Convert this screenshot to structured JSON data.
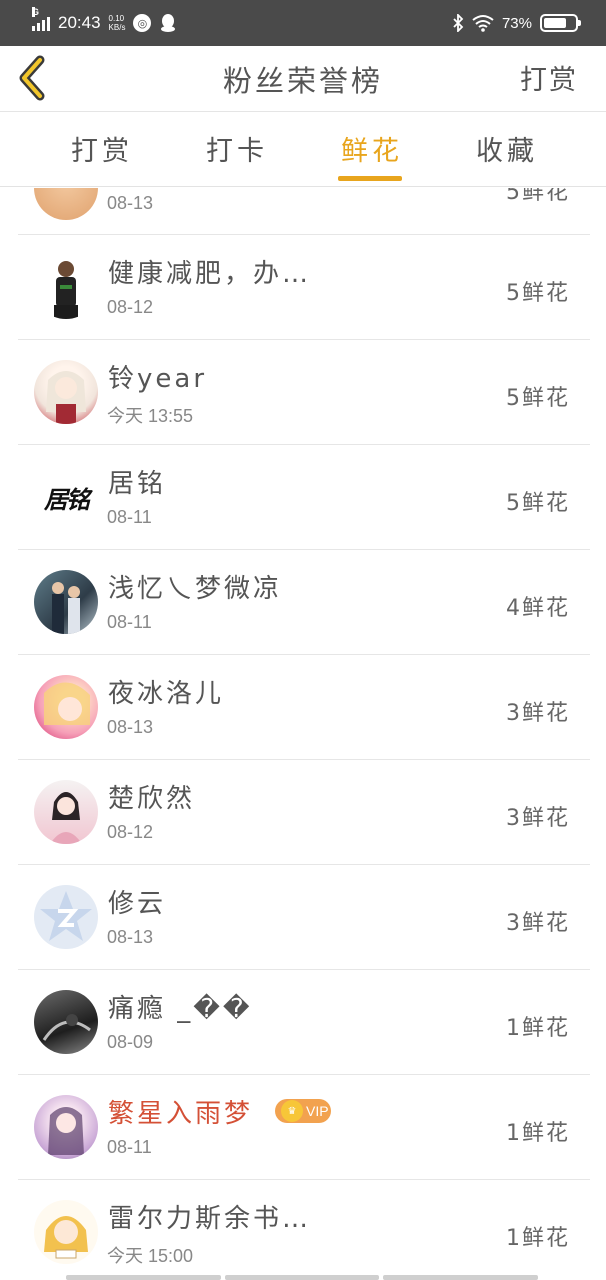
{
  "status_bar": {
    "network": "G",
    "time": "20:43",
    "speed_value": "0.10",
    "speed_unit": "KB/s",
    "battery": "73%",
    "battery_level": 0.73
  },
  "header": {
    "title": "粉丝荣誉榜",
    "action": "打赏"
  },
  "tabs": [
    {
      "label": "打赏",
      "active": false
    },
    {
      "label": "打卡",
      "active": false
    },
    {
      "label": "鲜花",
      "active": true
    },
    {
      "label": "收藏",
      "active": false
    }
  ],
  "list": {
    "partial_row": {
      "date": "08-13",
      "count": "5鲜花"
    },
    "rows": [
      {
        "name": "健康减肥，办…",
        "date": "08-12",
        "count": "5鲜花"
      },
      {
        "name": "铃year",
        "date": "今天  13:55",
        "count": "5鲜花"
      },
      {
        "name": "居铭",
        "date": "08-11",
        "count": "5鲜花"
      },
      {
        "name": "浅忆乀梦微凉",
        "date": "08-11",
        "count": "4鲜花"
      },
      {
        "name": "夜冰洛儿",
        "date": "08-13",
        "count": "3鲜花"
      },
      {
        "name": "楚欣然",
        "date": "08-12",
        "count": "3鲜花"
      },
      {
        "name": "修云",
        "date": "08-13",
        "count": "3鲜花"
      },
      {
        "name": "痛瘾 _��",
        "date": "08-09",
        "count": "1鲜花"
      },
      {
        "name": "繁星入雨梦",
        "date": "08-11",
        "count": "1鲜花",
        "vip": "VIP"
      },
      {
        "name": "雷尔力斯余书…",
        "date": "今天  15:00",
        "count": "1鲜花"
      }
    ]
  },
  "avatar_text": {
    "juming": "居铭"
  },
  "colors": {
    "accent": "#e8a51d",
    "vip_name": "#d45036",
    "status_bar": "#4a4a4a"
  }
}
